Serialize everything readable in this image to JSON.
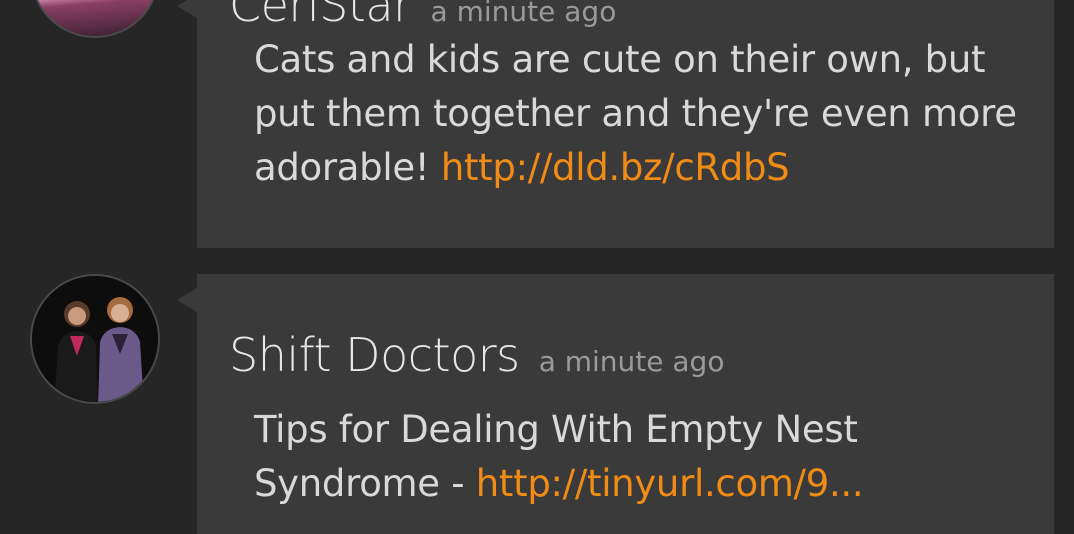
{
  "feed": [
    {
      "author": "CeriStar",
      "time": "a minute ago",
      "text": "Cats and kids are cute on their own, but put them together and they're even more adorable! ",
      "link": "http://dld.bz/cRdbS"
    },
    {
      "author": "Shift Doctors",
      "time": "a minute ago",
      "text": "Tips for Dealing With Empty Nest Syndrome - ",
      "link": "http://tinyurl.com/9..."
    }
  ],
  "colors": {
    "background": "#262626",
    "card": "#3a3a3a",
    "link": "#f08b16"
  }
}
